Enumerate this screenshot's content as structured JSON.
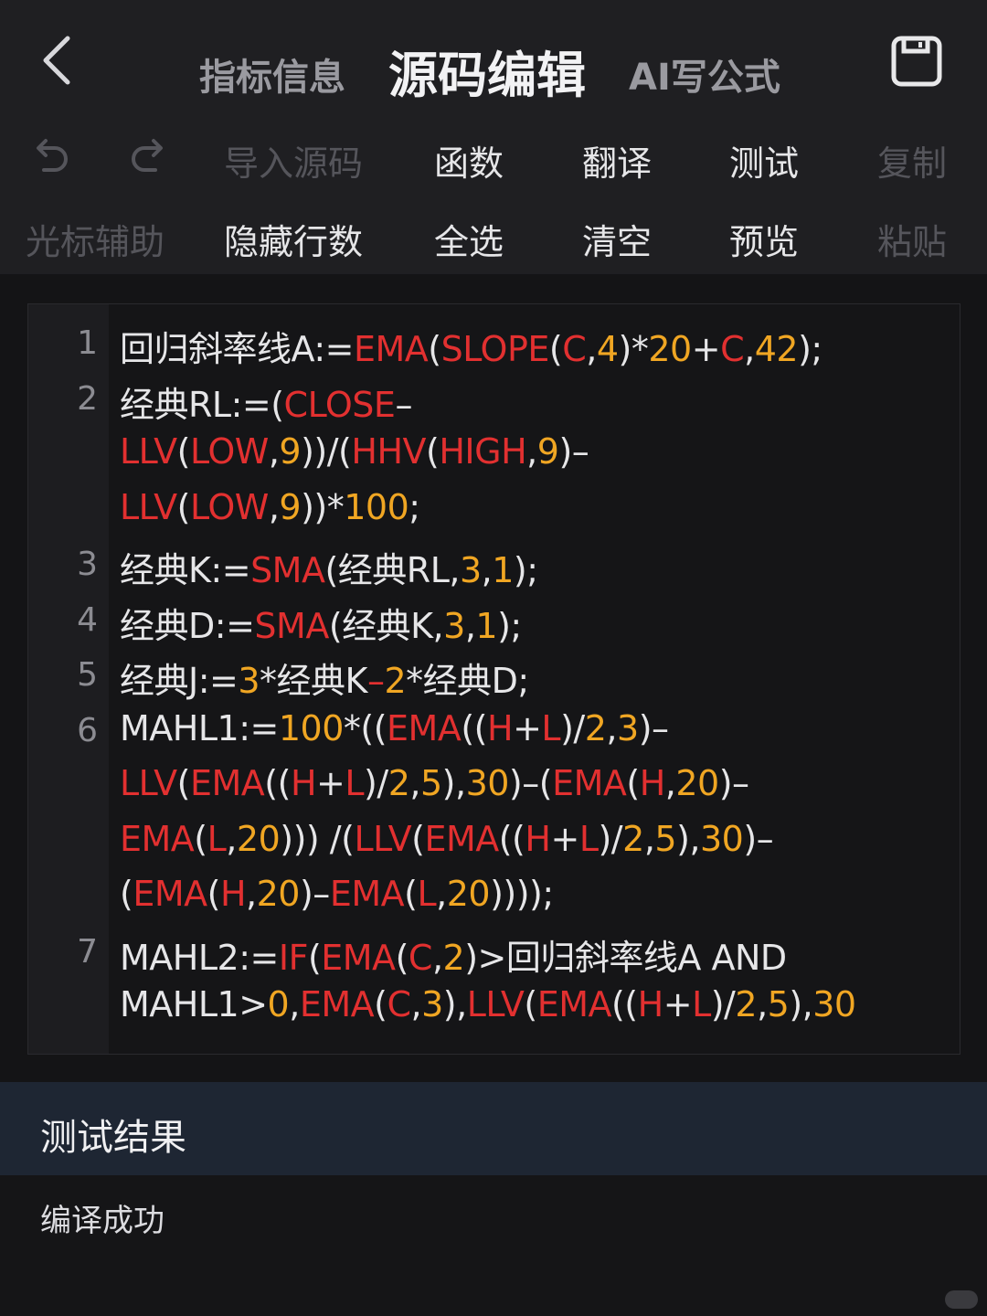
{
  "header": {
    "tab_info": "指标信息",
    "tab_source": "源码编辑",
    "tab_ai": "AI写公式"
  },
  "toolbar": {
    "row1": [
      "导入源码",
      "函数",
      "翻译",
      "测试",
      "复制"
    ],
    "row2": [
      "光标辅助",
      "隐藏行数",
      "全选",
      "清空",
      "预览",
      "粘贴"
    ]
  },
  "editor": {
    "lines": [
      {
        "n": "1",
        "segs": [
          [
            "t",
            "回归斜率线A:="
          ],
          [
            "f",
            "EMA"
          ],
          [
            "t",
            "("
          ],
          [
            "f",
            "SLOPE"
          ],
          [
            "t",
            "("
          ],
          [
            "f",
            "C"
          ],
          [
            "t",
            ","
          ],
          [
            "n",
            "4"
          ],
          [
            "t",
            ")*"
          ],
          [
            "n",
            "20"
          ],
          [
            "t",
            "+"
          ],
          [
            "f",
            "C"
          ],
          [
            "t",
            ","
          ],
          [
            "n",
            "42"
          ],
          [
            "t",
            ");"
          ]
        ]
      },
      {
        "n": "2",
        "segs": [
          [
            "t",
            "经典RL:=("
          ],
          [
            "f",
            "CLOSE"
          ],
          [
            "t",
            "–"
          ]
        ]
      },
      {
        "n": "",
        "segs": [
          [
            "f",
            "LLV"
          ],
          [
            "t",
            "("
          ],
          [
            "f",
            "LOW"
          ],
          [
            "t",
            ","
          ],
          [
            "n",
            "9"
          ],
          [
            "t",
            "))/("
          ],
          [
            "f",
            "HHV"
          ],
          [
            "t",
            "("
          ],
          [
            "f",
            "HIGH"
          ],
          [
            "t",
            ","
          ],
          [
            "n",
            "9"
          ],
          [
            "t",
            ")–"
          ]
        ]
      },
      {
        "n": "",
        "segs": [
          [
            "f",
            "LLV"
          ],
          [
            "t",
            "("
          ],
          [
            "f",
            "LOW"
          ],
          [
            "t",
            ","
          ],
          [
            "n",
            "9"
          ],
          [
            "t",
            "))*"
          ],
          [
            "n",
            "100"
          ],
          [
            "t",
            ";"
          ]
        ]
      },
      {
        "n": "3",
        "segs": [
          [
            "t",
            "经典K:="
          ],
          [
            "f",
            "SMA"
          ],
          [
            "t",
            "(经典RL,"
          ],
          [
            "n",
            "3"
          ],
          [
            "t",
            ","
          ],
          [
            "n",
            "1"
          ],
          [
            "t",
            ");"
          ]
        ]
      },
      {
        "n": "4",
        "segs": [
          [
            "t",
            "经典D:="
          ],
          [
            "f",
            "SMA"
          ],
          [
            "t",
            "(经典K,"
          ],
          [
            "n",
            "3"
          ],
          [
            "t",
            ","
          ],
          [
            "n",
            "1"
          ],
          [
            "t",
            ");"
          ]
        ]
      },
      {
        "n": "5",
        "segs": [
          [
            "t",
            "经典J:="
          ],
          [
            "n",
            "3"
          ],
          [
            "t",
            "*经典K"
          ],
          [
            "f",
            "–"
          ],
          [
            "n",
            "2"
          ],
          [
            "t",
            "*经典D;"
          ]
        ]
      },
      {
        "n": "6",
        "segs": [
          [
            "t",
            "MAHL1:="
          ],
          [
            "n",
            "100"
          ],
          [
            "t",
            "*(("
          ],
          [
            "f",
            "EMA"
          ],
          [
            "t",
            "(("
          ],
          [
            "f",
            "H"
          ],
          [
            "t",
            "+"
          ],
          [
            "f",
            "L"
          ],
          [
            "t",
            ")/"
          ],
          [
            "n",
            "2"
          ],
          [
            "t",
            ","
          ],
          [
            "n",
            "3"
          ],
          [
            "t",
            ")–"
          ]
        ]
      },
      {
        "n": "",
        "segs": [
          [
            "f",
            "LLV"
          ],
          [
            "t",
            "("
          ],
          [
            "f",
            "EMA"
          ],
          [
            "t",
            "(("
          ],
          [
            "f",
            "H"
          ],
          [
            "t",
            "+"
          ],
          [
            "f",
            "L"
          ],
          [
            "t",
            ")/"
          ],
          [
            "n",
            "2"
          ],
          [
            "t",
            ","
          ],
          [
            "n",
            "5"
          ],
          [
            "t",
            "),"
          ],
          [
            "n",
            "30"
          ],
          [
            "t",
            ")–("
          ],
          [
            "f",
            "EMA"
          ],
          [
            "t",
            "("
          ],
          [
            "f",
            "H"
          ],
          [
            "t",
            ","
          ],
          [
            "n",
            "20"
          ],
          [
            "t",
            ")–"
          ]
        ]
      },
      {
        "n": "",
        "segs": [
          [
            "f",
            "EMA"
          ],
          [
            "t",
            "("
          ],
          [
            "f",
            "L"
          ],
          [
            "t",
            ","
          ],
          [
            "n",
            "20"
          ],
          [
            "t",
            ")))  /("
          ],
          [
            "f",
            "LLV"
          ],
          [
            "t",
            "("
          ],
          [
            "f",
            "EMA"
          ],
          [
            "t",
            "(("
          ],
          [
            "f",
            "H"
          ],
          [
            "t",
            "+"
          ],
          [
            "f",
            "L"
          ],
          [
            "t",
            ")/"
          ],
          [
            "n",
            "2"
          ],
          [
            "t",
            ","
          ],
          [
            "n",
            "5"
          ],
          [
            "t",
            "),"
          ],
          [
            "n",
            "30"
          ],
          [
            "t",
            ")–"
          ]
        ]
      },
      {
        "n": "",
        "segs": [
          [
            "t",
            "("
          ],
          [
            "f",
            "EMA"
          ],
          [
            "t",
            "("
          ],
          [
            "f",
            "H"
          ],
          [
            "t",
            ","
          ],
          [
            "n",
            "20"
          ],
          [
            "t",
            ")–"
          ],
          [
            "f",
            "EMA"
          ],
          [
            "t",
            "("
          ],
          [
            "f",
            "L"
          ],
          [
            "t",
            ","
          ],
          [
            "n",
            "20"
          ],
          [
            "t",
            "))));"
          ]
        ]
      },
      {
        "n": "7",
        "segs": [
          [
            "t",
            "MAHL2:="
          ],
          [
            "f",
            "IF"
          ],
          [
            "t",
            "("
          ],
          [
            "f",
            "EMA"
          ],
          [
            "t",
            "("
          ],
          [
            "f",
            "C"
          ],
          [
            "t",
            ","
          ],
          [
            "n",
            "2"
          ],
          [
            "t",
            ")>回归斜率线A AND"
          ]
        ]
      },
      {
        "n": "",
        "segs": [
          [
            "t",
            "MAHL1>"
          ],
          [
            "n",
            "0"
          ],
          [
            "t",
            ","
          ],
          [
            "f",
            "EMA"
          ],
          [
            "t",
            "("
          ],
          [
            "f",
            "C"
          ],
          [
            "t",
            ","
          ],
          [
            "n",
            "3"
          ],
          [
            "t",
            "),"
          ],
          [
            "f",
            "LLV"
          ],
          [
            "t",
            "("
          ],
          [
            "f",
            "EMA"
          ],
          [
            "t",
            "(("
          ],
          [
            "f",
            "H"
          ],
          [
            "t",
            "+"
          ],
          [
            "f",
            "L"
          ],
          [
            "t",
            ")/"
          ],
          [
            "n",
            "2"
          ],
          [
            "t",
            ","
          ],
          [
            "n",
            "5"
          ],
          [
            "t",
            "),"
          ],
          [
            "n",
            "30"
          ]
        ]
      }
    ]
  },
  "result": {
    "title": "测试结果",
    "message": "编译成功"
  },
  "colors": {
    "function": "#e23030",
    "number": "#f0a623",
    "text": "#e6e6e8",
    "result_header_bg": "#1e2633"
  },
  "icons": [
    "back-chevron-icon",
    "save-icon",
    "undo-icon",
    "redo-icon"
  ]
}
